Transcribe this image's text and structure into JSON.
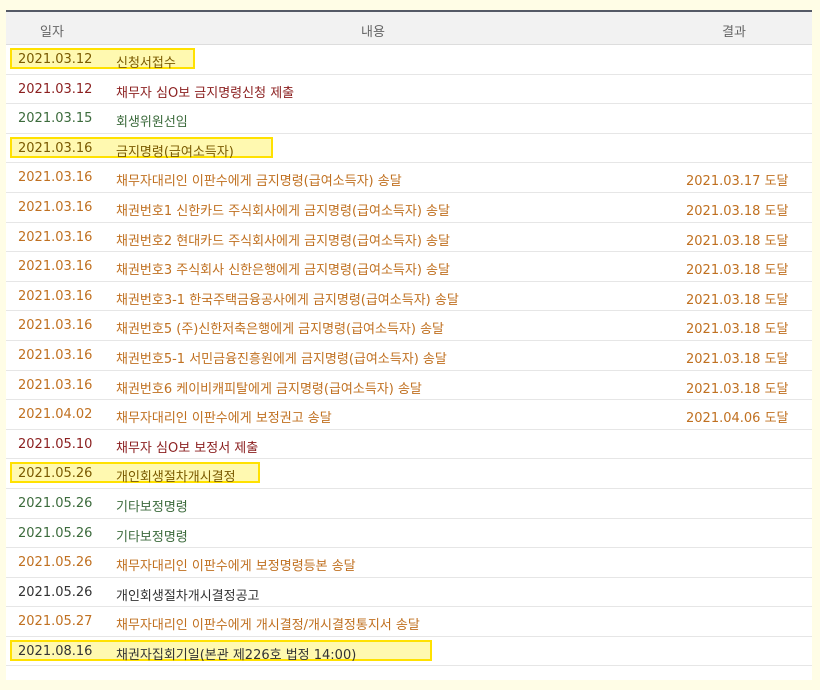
{
  "headers": {
    "date": "일자",
    "content": "내용",
    "result": "결과"
  },
  "rows": [
    {
      "date": "2021.03.12",
      "content": "신청서접수",
      "result": "",
      "color": "#7a5a00",
      "hl": true
    },
    {
      "date": "2021.03.12",
      "content": "채무자 심O보 금지명령신청 제출",
      "result": "",
      "color": "#8b1f1f",
      "hl": false
    },
    {
      "date": "2021.03.15",
      "content": "회생위원선임",
      "result": "",
      "color": "#3c6b3c",
      "hl": false
    },
    {
      "date": "2021.03.16",
      "content": "금지명령(급여소득자)",
      "result": "",
      "color": "#7a5a00",
      "hl": true
    },
    {
      "date": "2021.03.16",
      "content": "채무자대리인 이판수에게 금지명령(급여소득자) 송달",
      "result": "2021.03.17 도달",
      "color": "#c07020",
      "hl": false
    },
    {
      "date": "2021.03.16",
      "content": "채권번호1 신한카드 주식회사에게 금지명령(급여소득자) 송달",
      "result": "2021.03.18 도달",
      "color": "#c07020",
      "hl": false
    },
    {
      "date": "2021.03.16",
      "content": "채권번호2 현대카드 주식회사에게 금지명령(급여소득자) 송달",
      "result": "2021.03.18 도달",
      "color": "#c07020",
      "hl": false
    },
    {
      "date": "2021.03.16",
      "content": "채권번호3 주식회사 신한은행에게 금지명령(급여소득자) 송달",
      "result": "2021.03.18 도달",
      "color": "#c07020",
      "hl": false
    },
    {
      "date": "2021.03.16",
      "content": "채권번호3-1 한국주택금융공사에게 금지명령(급여소득자) 송달",
      "result": "2021.03.18 도달",
      "color": "#c07020",
      "hl": false
    },
    {
      "date": "2021.03.16",
      "content": "채권번호5 (주)신한저축은행에게 금지명령(급여소득자) 송달",
      "result": "2021.03.18 도달",
      "color": "#c07020",
      "hl": false
    },
    {
      "date": "2021.03.16",
      "content": "채권번호5-1 서민금융진흥원에게 금지명령(급여소득자) 송달",
      "result": "2021.03.18 도달",
      "color": "#c07020",
      "hl": false
    },
    {
      "date": "2021.03.16",
      "content": "채권번호6 케이비캐피탈에게 금지명령(급여소득자) 송달",
      "result": "2021.03.18 도달",
      "color": "#c07020",
      "hl": false
    },
    {
      "date": "2021.04.02",
      "content": "채무자대리인 이판수에게 보정권고 송달",
      "result": "2021.04.06 도달",
      "color": "#c07020",
      "hl": false
    },
    {
      "date": "2021.05.10",
      "content": "채무자 심O보 보정서 제출",
      "result": "",
      "color": "#8b1f1f",
      "hl": false
    },
    {
      "date": "2021.05.26",
      "content": "개인회생절차개시결정",
      "result": "",
      "color": "#7a5a00",
      "hl": true
    },
    {
      "date": "2021.05.26",
      "content": "기타보정명령",
      "result": "",
      "color": "#3c6b3c",
      "hl": false
    },
    {
      "date": "2021.05.26",
      "content": "기타보정명령",
      "result": "",
      "color": "#3c6b3c",
      "hl": false
    },
    {
      "date": "2021.05.26",
      "content": "채무자대리인 이판수에게 보정명령등본 송달",
      "result": "",
      "color": "#c07020",
      "hl": false
    },
    {
      "date": "2021.05.26",
      "content": "개인회생절차개시결정공고",
      "result": "",
      "color": "#333333",
      "hl": false
    },
    {
      "date": "2021.05.27",
      "content": "채무자대리인 이판수에게 개시결정/개시결정통지서 송달",
      "result": "",
      "color": "#c07020",
      "hl": false
    },
    {
      "date": "2021.08.16",
      "content": "채권자집회기일(본관 제226호 법정 14:00)",
      "result": "",
      "color": "#333333",
      "hl": true
    }
  ]
}
